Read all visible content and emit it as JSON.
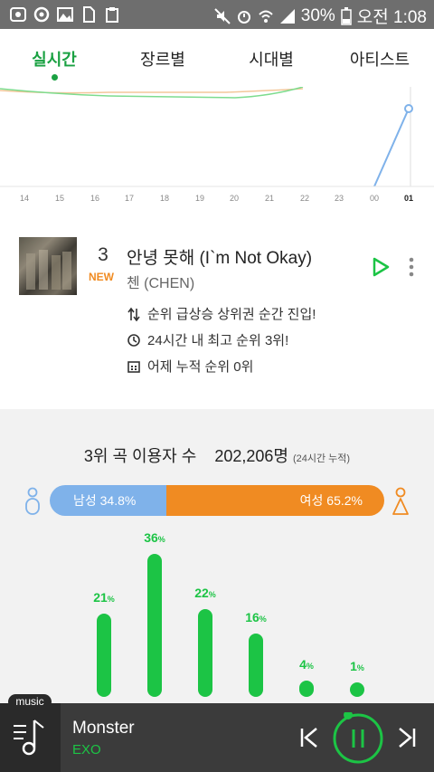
{
  "status_bar": {
    "battery": "30%",
    "time": "오전 1:08"
  },
  "tabs": [
    {
      "label": "실시간",
      "active": true
    },
    {
      "label": "장르별",
      "active": false
    },
    {
      "label": "시대별",
      "active": false
    },
    {
      "label": "아티스트",
      "active": false
    }
  ],
  "graph": {
    "x_ticks": [
      "14",
      "15",
      "16",
      "17",
      "18",
      "19",
      "20",
      "21",
      "22",
      "23",
      "00",
      "01"
    ]
  },
  "song": {
    "rank": "3",
    "badge": "NEW",
    "title": "안녕 못해 (I`m Not Okay)",
    "artist": "첸 (CHEN)",
    "info": [
      {
        "icon": "rank-up-icon",
        "text": "순위 급상승 상위권 순간 진입!"
      },
      {
        "icon": "clock-icon",
        "text": "24시간 내 최고 순위 3위!"
      },
      {
        "icon": "calendar-icon",
        "text": "어제 누적 순위 0위"
      }
    ]
  },
  "listeners": {
    "label": "3위 곡 이용자 수",
    "count": "202,206명",
    "sub": "(24시간 누적)"
  },
  "gender": {
    "male_label": "남성 34.8%",
    "female_label": "여성 65.2%",
    "male_fraction": 0.348,
    "female_fraction": 0.652
  },
  "age_bars": [
    {
      "value": "21",
      "pct": 21
    },
    {
      "value": "36",
      "pct": 36
    },
    {
      "value": "22",
      "pct": 22
    },
    {
      "value": "16",
      "pct": 16
    },
    {
      "value": "4",
      "pct": 4
    },
    {
      "value": "1",
      "pct": 1
    }
  ],
  "percent_suffix": "%",
  "player": {
    "badge": "music",
    "title": "Monster",
    "artist": "EXO"
  },
  "colors": {
    "accent_green": "#1aa142",
    "bar_green": "#1cc445",
    "male_blue": "#7fb2ea",
    "female_orange": "#f08b22"
  }
}
